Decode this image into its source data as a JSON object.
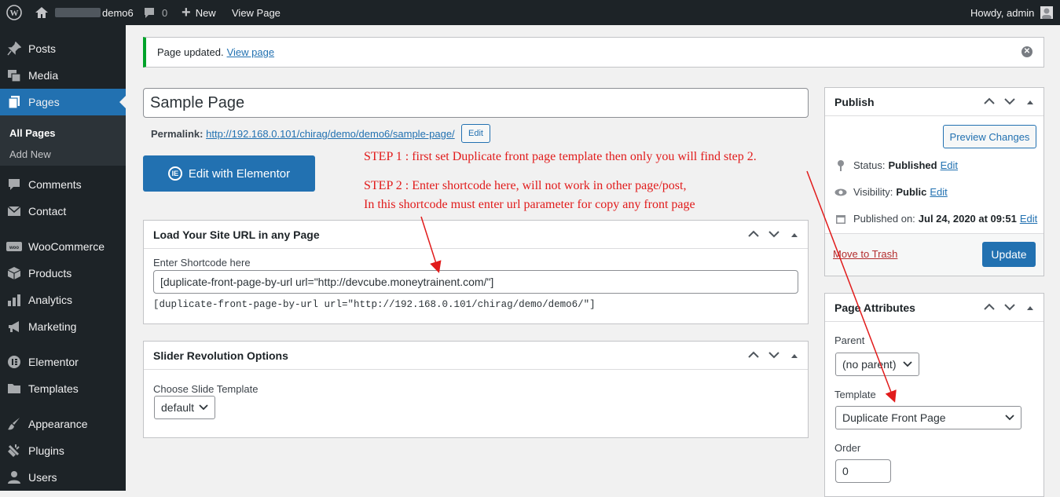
{
  "admin_bar": {
    "site_name": "demo6",
    "comment_count": "0",
    "new_label": "New",
    "view_page_label": "View Page",
    "greeting": "Howdy, admin"
  },
  "sidebar": {
    "items": [
      {
        "label": "Posts",
        "icon": "pin-icon"
      },
      {
        "label": "Media",
        "icon": "media-icon"
      },
      {
        "label": "Pages",
        "icon": "pages-icon"
      },
      {
        "label": "Comments",
        "icon": "comment-icon"
      },
      {
        "label": "Contact",
        "icon": "envelope-icon"
      },
      {
        "label": "WooCommerce",
        "icon": "woo-icon"
      },
      {
        "label": "Products",
        "icon": "box-icon"
      },
      {
        "label": "Analytics",
        "icon": "bar-chart-icon"
      },
      {
        "label": "Marketing",
        "icon": "megaphone-icon"
      },
      {
        "label": "Elementor",
        "icon": "elementor-icon"
      },
      {
        "label": "Templates",
        "icon": "folder-icon"
      },
      {
        "label": "Appearance",
        "icon": "brush-icon"
      },
      {
        "label": "Plugins",
        "icon": "plug-icon"
      },
      {
        "label": "Users",
        "icon": "user-icon"
      }
    ],
    "submenu": {
      "all_pages": "All Pages",
      "add_new": "Add New"
    }
  },
  "notice": {
    "text": "Page updated.",
    "link": "View page"
  },
  "editor": {
    "title": "Sample Page",
    "permalink_label": "Permalink:",
    "permalink_url": "http://192.168.0.101/chirag/demo/demo6/sample-page/",
    "edit_label": "Edit",
    "elementor_button": "Edit with Elementor"
  },
  "annotations": {
    "step1": "STEP 1 : first set Duplicate front page template then only you will find step 2.",
    "step2_line1": "STEP 2 : Enter shortcode here, will not work in other page/post,",
    "step2_line2": "In this shortcode must enter url parameter for copy any front page",
    "color": "#e11b1b"
  },
  "site_url_box": {
    "title": "Load Your Site URL in any Page",
    "field_label": "Enter Shortcode here",
    "field_value": "[duplicate-front-page-by-url url=\"http://devcube.moneytrainent.com/\"]",
    "example": "[duplicate-front-page-by-url url=\"http://192.168.0.101/chirag/demo/demo6/\"]"
  },
  "slider_box": {
    "title": "Slider Revolution Options",
    "field_label": "Choose Slide Template",
    "selected": "default"
  },
  "publish": {
    "title": "Publish",
    "preview_button": "Preview Changes",
    "status_label": "Status:",
    "status_value": "Published",
    "visibility_label": "Visibility:",
    "visibility_value": "Public",
    "published_label": "Published on:",
    "published_value": "Jul 24, 2020 at 09:51",
    "edit_label": "Edit",
    "trash_label": "Move to Trash",
    "update_button": "Update"
  },
  "page_attributes": {
    "title": "Page Attributes",
    "parent_label": "Parent",
    "parent_value": "(no parent)",
    "template_label": "Template",
    "template_value": "Duplicate Front Page",
    "order_label": "Order",
    "order_value": "0"
  },
  "colors": {
    "admin_bar": "#1d2327",
    "accent": "#2271b1",
    "success": "#00a32a"
  }
}
